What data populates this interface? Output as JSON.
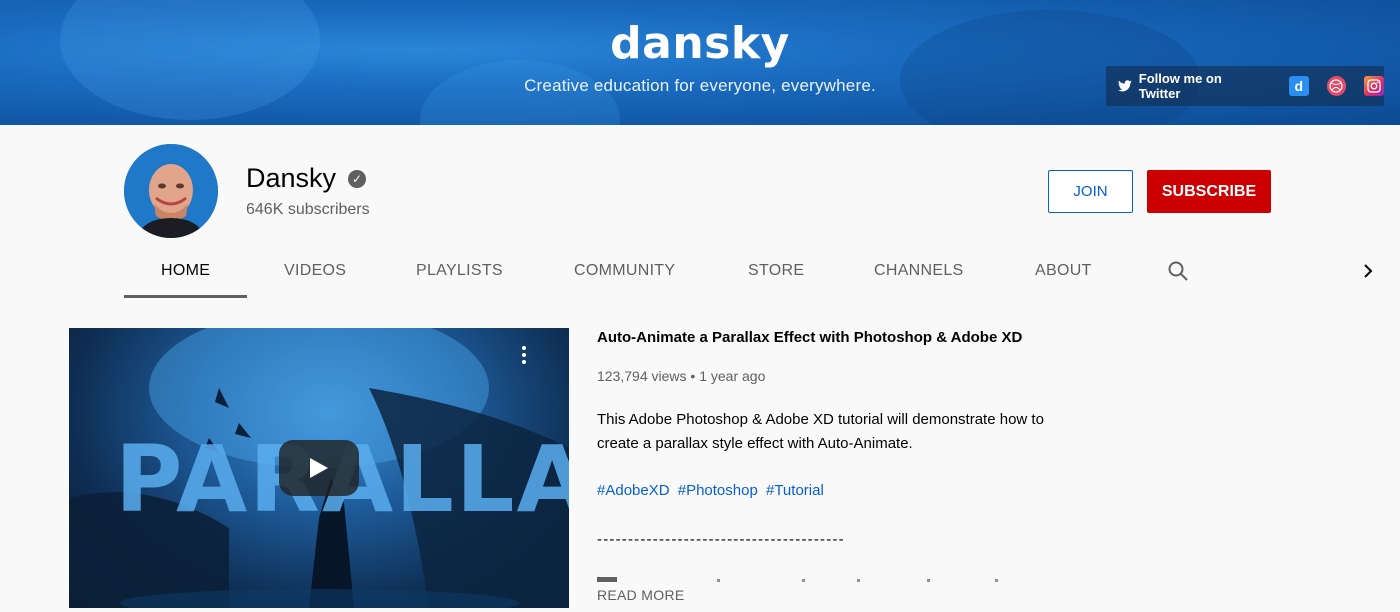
{
  "banner": {
    "brand": "dansky",
    "tagline": "Creative education for everyone, everywhere.",
    "twitter_label": "Follow me on Twitter",
    "social_icons": [
      "twitter-icon",
      "dribbble-d-icon",
      "dribbble-icon",
      "instagram-icon"
    ],
    "d_letter": "d",
    "accent": "#1a6cc1"
  },
  "channel": {
    "name": "Dansky",
    "verified_mark": "✓",
    "subscribers": "646K subscribers",
    "join_label": "JOIN",
    "subscribe_label": "SUBSCRIBE",
    "subscribe_color": "#cc0000"
  },
  "tabs": [
    {
      "label": "HOME",
      "active": true
    },
    {
      "label": "VIDEOS"
    },
    {
      "label": "PLAYLISTS"
    },
    {
      "label": "COMMUNITY"
    },
    {
      "label": "STORE"
    },
    {
      "label": "CHANNELS"
    },
    {
      "label": "ABOUT"
    }
  ],
  "featured_video": {
    "thumbnail_text": "PARALLAX",
    "title": "Auto-Animate a Parallax Effect with Photoshop & Adobe XD",
    "views": "123,794 views",
    "separator": "•",
    "age": "1 year ago",
    "description": "This Adobe Photoshop & Adobe XD tutorial will demonstrate how to create a parallax style effect with Auto-Animate.",
    "tags": [
      "#AdobeXD",
      "#Photoshop",
      "#Tutorial"
    ],
    "divider": "----------------------------------------",
    "read_more": "READ MORE"
  }
}
